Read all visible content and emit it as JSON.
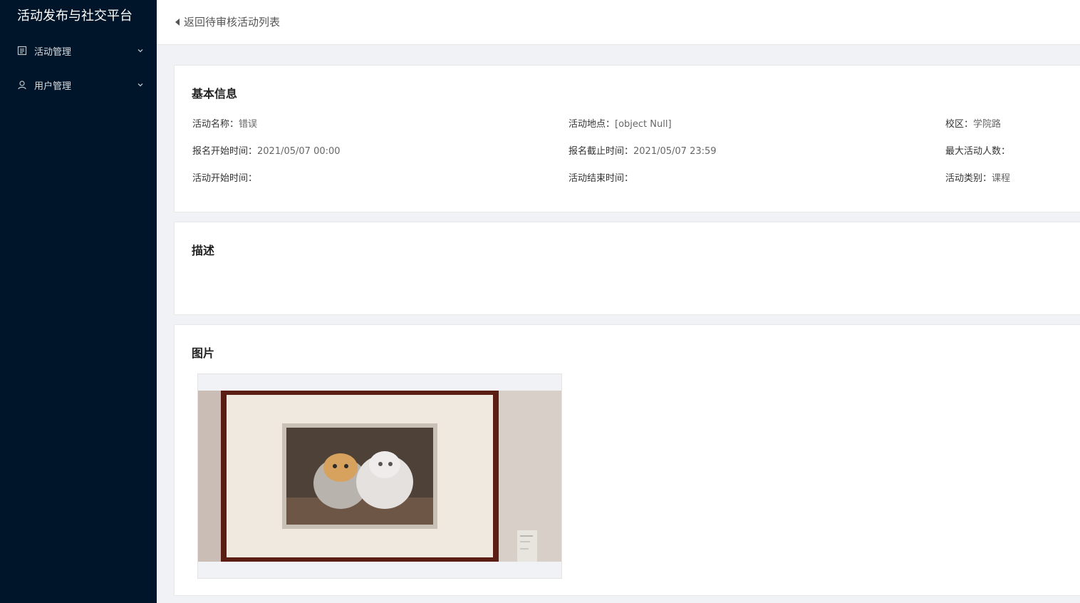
{
  "app": {
    "title": "活动发布与社交平台"
  },
  "sidebar": {
    "items": [
      {
        "label": "活动管理",
        "icon": "list-icon"
      },
      {
        "label": "用户管理",
        "icon": "user-icon"
      }
    ]
  },
  "header": {
    "back_label": "返回待审核活动列表"
  },
  "basic_info": {
    "title": "基本信息",
    "fields": {
      "name_key": "活动名称：",
      "name_val": "错误",
      "location_key": "活动地点：",
      "location_val": "[object Null]",
      "campus_key": "校区：",
      "campus_val": "学院路",
      "reg_start_key": "报名开始时间：",
      "reg_start_val": "2021/05/07 00:00",
      "reg_end_key": "报名截止时间：",
      "reg_end_val": "2021/05/07 23:59",
      "max_people_key": "最大活动人数：",
      "max_people_val": "",
      "start_key": "活动开始时间：",
      "start_val": "",
      "end_key": "活动结束时间：",
      "end_val": "",
      "category_key": "活动类别：",
      "category_val": "课程"
    }
  },
  "description": {
    "title": "描述",
    "text": ""
  },
  "images": {
    "title": "图片"
  },
  "colors": {
    "sidebar_bg": "#001529",
    "page_bg": "#f0f2f5",
    "card_bg": "#ffffff"
  }
}
